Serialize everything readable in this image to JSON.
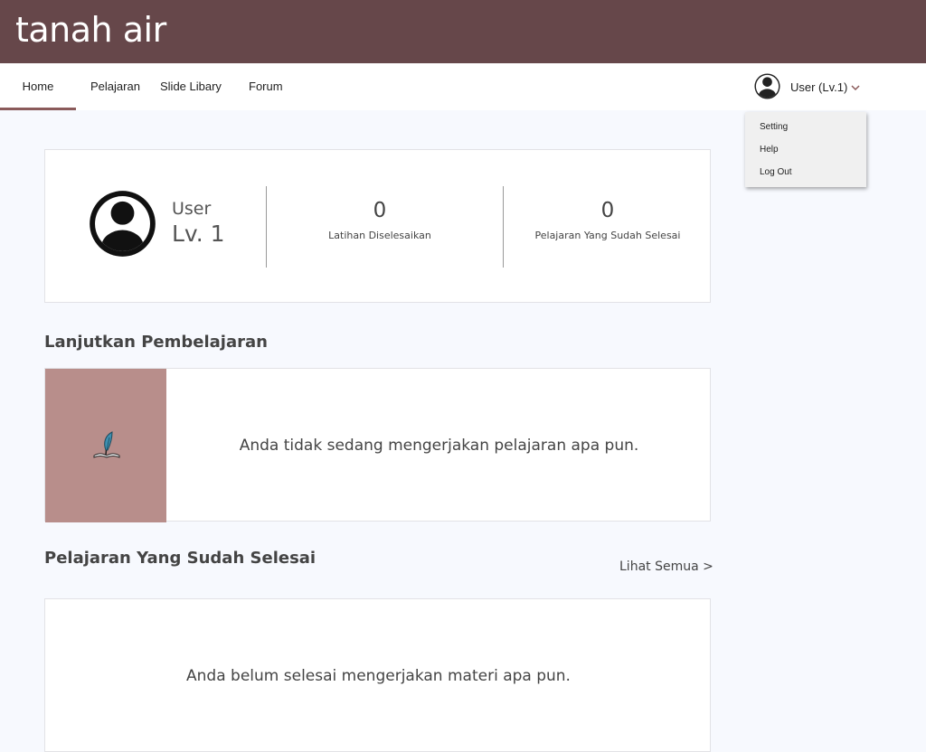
{
  "app": {
    "brand": "tanah air"
  },
  "nav": {
    "items": [
      {
        "label": "Home",
        "active": true
      },
      {
        "label": "Pelajaran"
      },
      {
        "label": "Slide Libary"
      },
      {
        "label": "Forum"
      }
    ]
  },
  "user_menu": {
    "label": "User (Lv.1)",
    "dropdown": [
      "Setting",
      "Help",
      "Log Out"
    ]
  },
  "profile": {
    "name": "User",
    "level": "Lv. 1",
    "stats": [
      {
        "value": "0",
        "label": "Latihan Diselesaikan"
      },
      {
        "value": "0",
        "label": "Pelajaran Yang Sudah Selesai"
      }
    ]
  },
  "continue_section": {
    "title": "Lanjutkan Pembelajaran",
    "empty_message": "Anda tidak sedang mengerjakan pelajaran apa pun."
  },
  "completed_section": {
    "title": "Pelajaran Yang Sudah Selesai",
    "see_all": "Lihat Semua >",
    "empty_message": "Anda belum selesai mengerjakan materi apa pun."
  },
  "colors": {
    "topbar": "#66474a",
    "active_tab_underline": "#8a5a5a",
    "thumbnail": "#b88e8b",
    "page_background": "#f7f9fe"
  },
  "icons": {
    "avatar": "user-circle-icon",
    "dropdown_arrow": "chevron-down-icon",
    "lesson_thumbnail": "quill-book-icon"
  }
}
